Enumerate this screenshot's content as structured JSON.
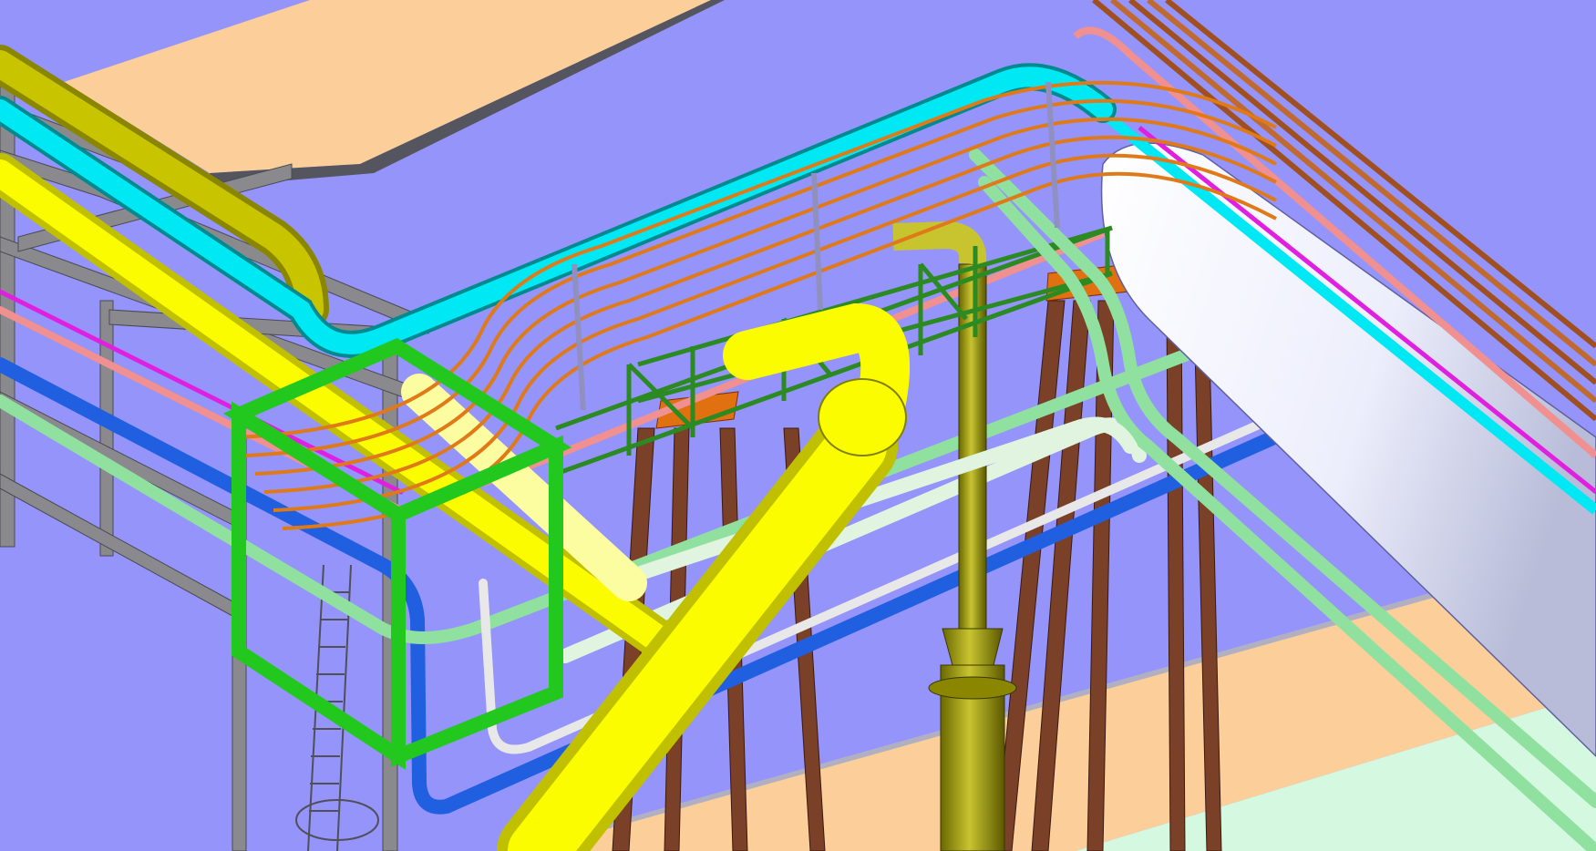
{
  "viewport": {
    "label": "",
    "background": "#9494fb"
  },
  "colors": {
    "floor_beige": "#fccf9a",
    "floor_mint": "#d4f8e0",
    "slab_edge": "#50505a",
    "frame_grey": "#8a8a8e",
    "frame_green": "#22c81e",
    "rack_green": "#2c8a22",
    "pipe_yellow": "#fcfc00",
    "pipe_olive": "#c8c400",
    "pipe_cyan": "#00e8f4",
    "pipe_blue": "#2060e0",
    "pipe_lightgreen": "#90e0a0",
    "pipe_pale": "#e0f4e0",
    "pipe_pink": "#f09090",
    "pipe_magenta": "#e020e0",
    "cable_orange": "#e07a18",
    "pipe_white": "#f0f0fc",
    "support_brown": "#7a4028",
    "support_orange": "#e07010"
  },
  "objects": [
    "yellow-main-pipe",
    "olive-pipe",
    "cyan-pipe",
    "white-large-duct",
    "green-frame",
    "grey-frame",
    "pipe-rack",
    "brown-supports",
    "ladder",
    "olive-column",
    "orange-cable-bundle"
  ]
}
